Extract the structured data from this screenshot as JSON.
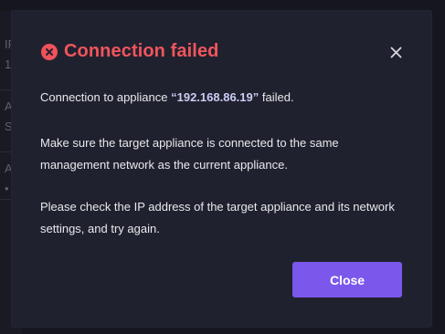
{
  "background": {
    "labels": [
      "IP",
      "1",
      "A",
      "S",
      "A",
      "•"
    ]
  },
  "dialog": {
    "title": "Connection failed",
    "title_icon": "error-circle-icon",
    "close_icon": "close-icon",
    "message": {
      "prefix": "Connection to appliance ",
      "ip": "“192.168.86.19”",
      "suffix": " failed."
    },
    "paragraph_2": "Make sure the target appliance is connected to the same management network as the current appliance.",
    "paragraph_3": "Please check the IP address of the target appliance and its network settings, and try again.",
    "close_button_label": "Close"
  },
  "colors": {
    "error": "#f0555d",
    "primary_button": "#7b57ec",
    "dialog_background": "#20212e",
    "ip_text": "#c9cdf4"
  }
}
